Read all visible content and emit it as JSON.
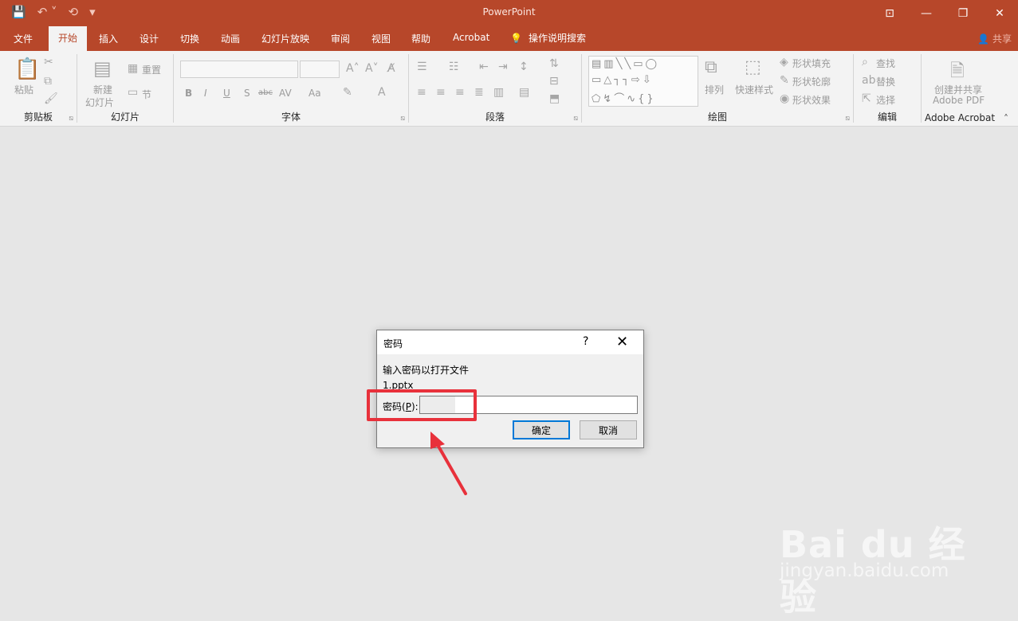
{
  "app": {
    "title": "PowerPoint"
  },
  "tabs": [
    {
      "label": "文件"
    },
    {
      "label": "开始"
    },
    {
      "label": "插入"
    },
    {
      "label": "设计"
    },
    {
      "label": "切换"
    },
    {
      "label": "动画"
    },
    {
      "label": "幻灯片放映"
    },
    {
      "label": "审阅"
    },
    {
      "label": "视图"
    },
    {
      "label": "帮助"
    },
    {
      "label": "Acrobat"
    }
  ],
  "search": {
    "label": "操作说明搜索"
  },
  "share": {
    "label": "共享"
  },
  "ribbon": {
    "clipboard": {
      "label": "剪贴板",
      "paste": "粘贴"
    },
    "slides": {
      "label": "幻灯片",
      "new_slide_1": "新建",
      "new_slide_2": "幻灯片",
      "reset": "重置",
      "section": "节"
    },
    "font": {
      "label": "字体",
      "bold": "B",
      "italic": "I",
      "underline": "U",
      "shadow": "S",
      "strike": "abc",
      "spacing": "AV",
      "case": "Aa"
    },
    "paragraph": {
      "label": "段落"
    },
    "drawing": {
      "label": "绘图",
      "arrange": "排列",
      "quick_styles": "快速样式",
      "shape_fill": "形状填充",
      "shape_outline": "形状轮廓",
      "shape_effects": "形状效果"
    },
    "editing": {
      "label": "编辑",
      "find": "查找",
      "replace": "替换",
      "select": "选择"
    },
    "acrobat": {
      "label": "Adobe Acrobat",
      "create_1": "创建并共享",
      "create_2": "Adobe PDF"
    }
  },
  "dialog": {
    "title": "密码",
    "help": "?",
    "close": "✕",
    "message": "输入密码以打开文件",
    "filename": "1.pptx",
    "password_label_pre": "密码(",
    "password_label_key": "P",
    "password_label_post": "):",
    "ok": "确定",
    "cancel": "取消"
  },
  "watermark": {
    "logo": "Bai du 经验",
    "url": "jingyan.baidu.com"
  },
  "colors": {
    "accent": "#b7472a",
    "annotation": "#e8313b",
    "focus": "#0078d7"
  }
}
